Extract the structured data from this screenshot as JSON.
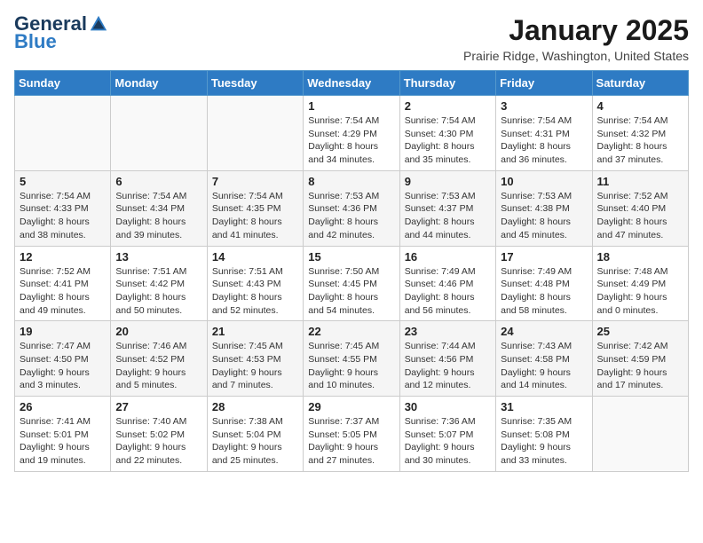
{
  "header": {
    "logo_general": "General",
    "logo_blue": "Blue",
    "title": "January 2025",
    "location": "Prairie Ridge, Washington, United States"
  },
  "calendar": {
    "days_of_week": [
      "Sunday",
      "Monday",
      "Tuesday",
      "Wednesday",
      "Thursday",
      "Friday",
      "Saturday"
    ],
    "weeks": [
      [
        {
          "day": "",
          "info": ""
        },
        {
          "day": "",
          "info": ""
        },
        {
          "day": "",
          "info": ""
        },
        {
          "day": "1",
          "info": "Sunrise: 7:54 AM\nSunset: 4:29 PM\nDaylight: 8 hours\nand 34 minutes."
        },
        {
          "day": "2",
          "info": "Sunrise: 7:54 AM\nSunset: 4:30 PM\nDaylight: 8 hours\nand 35 minutes."
        },
        {
          "day": "3",
          "info": "Sunrise: 7:54 AM\nSunset: 4:31 PM\nDaylight: 8 hours\nand 36 minutes."
        },
        {
          "day": "4",
          "info": "Sunrise: 7:54 AM\nSunset: 4:32 PM\nDaylight: 8 hours\nand 37 minutes."
        }
      ],
      [
        {
          "day": "5",
          "info": "Sunrise: 7:54 AM\nSunset: 4:33 PM\nDaylight: 8 hours\nand 38 minutes."
        },
        {
          "day": "6",
          "info": "Sunrise: 7:54 AM\nSunset: 4:34 PM\nDaylight: 8 hours\nand 39 minutes."
        },
        {
          "day": "7",
          "info": "Sunrise: 7:54 AM\nSunset: 4:35 PM\nDaylight: 8 hours\nand 41 minutes."
        },
        {
          "day": "8",
          "info": "Sunrise: 7:53 AM\nSunset: 4:36 PM\nDaylight: 8 hours\nand 42 minutes."
        },
        {
          "day": "9",
          "info": "Sunrise: 7:53 AM\nSunset: 4:37 PM\nDaylight: 8 hours\nand 44 minutes."
        },
        {
          "day": "10",
          "info": "Sunrise: 7:53 AM\nSunset: 4:38 PM\nDaylight: 8 hours\nand 45 minutes."
        },
        {
          "day": "11",
          "info": "Sunrise: 7:52 AM\nSunset: 4:40 PM\nDaylight: 8 hours\nand 47 minutes."
        }
      ],
      [
        {
          "day": "12",
          "info": "Sunrise: 7:52 AM\nSunset: 4:41 PM\nDaylight: 8 hours\nand 49 minutes."
        },
        {
          "day": "13",
          "info": "Sunrise: 7:51 AM\nSunset: 4:42 PM\nDaylight: 8 hours\nand 50 minutes."
        },
        {
          "day": "14",
          "info": "Sunrise: 7:51 AM\nSunset: 4:43 PM\nDaylight: 8 hours\nand 52 minutes."
        },
        {
          "day": "15",
          "info": "Sunrise: 7:50 AM\nSunset: 4:45 PM\nDaylight: 8 hours\nand 54 minutes."
        },
        {
          "day": "16",
          "info": "Sunrise: 7:49 AM\nSunset: 4:46 PM\nDaylight: 8 hours\nand 56 minutes."
        },
        {
          "day": "17",
          "info": "Sunrise: 7:49 AM\nSunset: 4:48 PM\nDaylight: 8 hours\nand 58 minutes."
        },
        {
          "day": "18",
          "info": "Sunrise: 7:48 AM\nSunset: 4:49 PM\nDaylight: 9 hours\nand 0 minutes."
        }
      ],
      [
        {
          "day": "19",
          "info": "Sunrise: 7:47 AM\nSunset: 4:50 PM\nDaylight: 9 hours\nand 3 minutes."
        },
        {
          "day": "20",
          "info": "Sunrise: 7:46 AM\nSunset: 4:52 PM\nDaylight: 9 hours\nand 5 minutes."
        },
        {
          "day": "21",
          "info": "Sunrise: 7:45 AM\nSunset: 4:53 PM\nDaylight: 9 hours\nand 7 minutes."
        },
        {
          "day": "22",
          "info": "Sunrise: 7:45 AM\nSunset: 4:55 PM\nDaylight: 9 hours\nand 10 minutes."
        },
        {
          "day": "23",
          "info": "Sunrise: 7:44 AM\nSunset: 4:56 PM\nDaylight: 9 hours\nand 12 minutes."
        },
        {
          "day": "24",
          "info": "Sunrise: 7:43 AM\nSunset: 4:58 PM\nDaylight: 9 hours\nand 14 minutes."
        },
        {
          "day": "25",
          "info": "Sunrise: 7:42 AM\nSunset: 4:59 PM\nDaylight: 9 hours\nand 17 minutes."
        }
      ],
      [
        {
          "day": "26",
          "info": "Sunrise: 7:41 AM\nSunset: 5:01 PM\nDaylight: 9 hours\nand 19 minutes."
        },
        {
          "day": "27",
          "info": "Sunrise: 7:40 AM\nSunset: 5:02 PM\nDaylight: 9 hours\nand 22 minutes."
        },
        {
          "day": "28",
          "info": "Sunrise: 7:38 AM\nSunset: 5:04 PM\nDaylight: 9 hours\nand 25 minutes."
        },
        {
          "day": "29",
          "info": "Sunrise: 7:37 AM\nSunset: 5:05 PM\nDaylight: 9 hours\nand 27 minutes."
        },
        {
          "day": "30",
          "info": "Sunrise: 7:36 AM\nSunset: 5:07 PM\nDaylight: 9 hours\nand 30 minutes."
        },
        {
          "day": "31",
          "info": "Sunrise: 7:35 AM\nSunset: 5:08 PM\nDaylight: 9 hours\nand 33 minutes."
        },
        {
          "day": "",
          "info": ""
        }
      ]
    ]
  }
}
